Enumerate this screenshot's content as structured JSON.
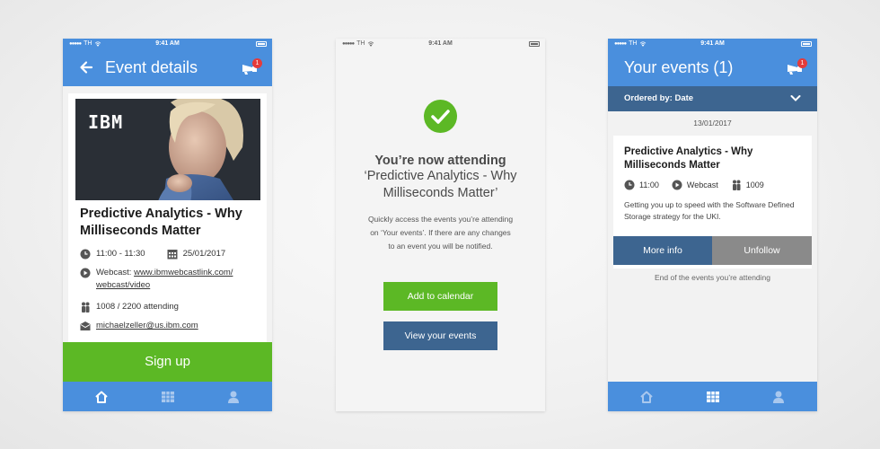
{
  "status": {
    "carrier": "TH",
    "time": "9:41 AM"
  },
  "screen1": {
    "title": "Event details",
    "notification_count": "1",
    "logo_text": "IBM",
    "event_title": "Predictive Analytics - Why Milliseconds Matter",
    "time_range": "11:00 - 11:30",
    "date": "25/01/2017",
    "webcast_label": "Webcast:",
    "webcast_link_line1": "www.ibmwebcastlink.com/",
    "webcast_link_line2": "webcast/video",
    "attendance": "1008 / 2200  attending",
    "email": "michaelzeller@us.ibm.com",
    "signup_label": "Sign up"
  },
  "screen2": {
    "heading": "You’re now attending",
    "event_name": "‘Predictive Analytics - Why Milliseconds Matter’",
    "body": "Quickly access the events you’re attending on ‘Your events’. If there are any changes to an event you will be notified.",
    "add_calendar_label": "Add to calendar",
    "view_events_label": "View your events"
  },
  "screen3": {
    "title": "Your events (1)",
    "notification_count": "1",
    "ordered_by": "Ordered by: Date",
    "date_header": "13/01/2017",
    "event_title": "Predictive Analytics - Why Milliseconds Matter",
    "time": "11:00",
    "type": "Webcast",
    "attendees": "1009",
    "description": "Getting you up to speed with the Software Defined Storage strategy for the UKI.",
    "more_info_label": "More info",
    "unfollow_label": "Unfollow",
    "end_text": "End of the events you’re attending"
  },
  "colors": {
    "primary_blue": "#4a8fdd",
    "dark_blue": "#3d6590",
    "green": "#5cb825",
    "badge_red": "#e53b3b",
    "grey_button": "#8a8a8a"
  },
  "icons": [
    "back-arrow-icon",
    "notification-icon",
    "clock-icon",
    "calendar-icon",
    "play-icon",
    "people-icon",
    "mail-icon",
    "home-icon",
    "grid-icon",
    "person-icon",
    "check-icon",
    "chevron-down-icon"
  ]
}
